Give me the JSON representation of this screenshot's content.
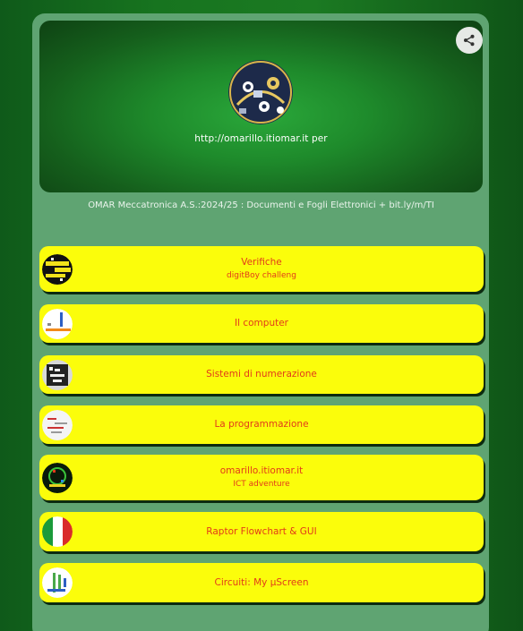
{
  "profile": {
    "url_text": "http://omarillo.itiomar.it per",
    "description": "OMAR Meccatronica A.S.:2024/25 : Documenti e Fogli Elettronici + bit.ly/m/TI"
  },
  "links": [
    {
      "title": "Verifiche",
      "subtitle": "digitBoy challeng"
    },
    {
      "title": "Il computer",
      "subtitle": ""
    },
    {
      "title": "Sistemi di numerazione",
      "subtitle": ""
    },
    {
      "title": "La programmazione",
      "subtitle": ""
    },
    {
      "title": "omarillo.itiomar.it",
      "subtitle": "ICT adventure"
    },
    {
      "title": "Raptor Flowchart & GUI",
      "subtitle": ""
    },
    {
      "title": "Circuiti: My µScreen",
      "subtitle": ""
    }
  ],
  "icons": {
    "share": "share-icon",
    "thumbs": [
      "verifiche-thumbnail",
      "computer-thumbnail",
      "numerazione-thumbnail",
      "programmazione-thumbnail",
      "ict-adventure-thumbnail",
      "italy-flag-thumbnail",
      "circuit-thumbnail"
    ]
  },
  "colors": {
    "background": "#17741f",
    "panel": "#5fa472",
    "button_fill": "#fbfd0b",
    "button_text": "#e23a1a",
    "button_shadow": "#0c2b10"
  }
}
